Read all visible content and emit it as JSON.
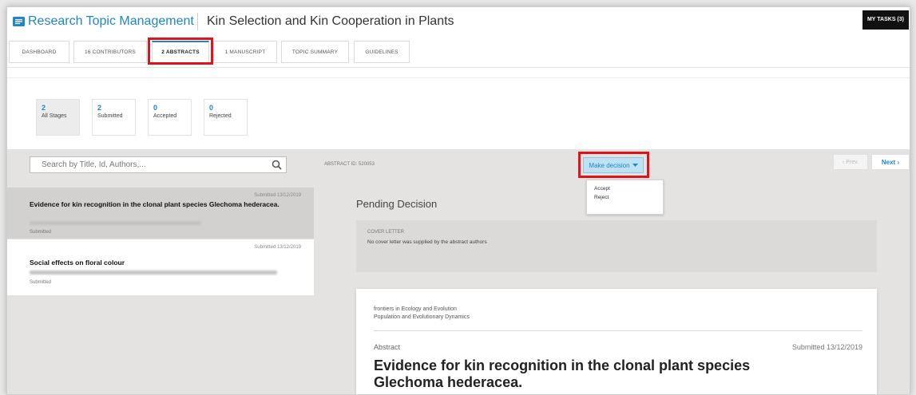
{
  "header": {
    "app_title": "Research Topic Management",
    "topic_title": "Kin Selection and Kin Cooperation in Plants",
    "tasks_button": "MY TASKS (3)"
  },
  "tabs": [
    {
      "label": "DASHBOARD",
      "active": false
    },
    {
      "label": "16 CONTRIBUTORS",
      "active": false
    },
    {
      "label": "2 ABSTRACTS",
      "active": true
    },
    {
      "label": "1 MANUSCRIPT",
      "active": false
    },
    {
      "label": "TOPIC SUMMARY",
      "active": false
    },
    {
      "label": "GUIDELINES",
      "active": false
    }
  ],
  "stats": [
    {
      "count": "2",
      "label": "All Stages",
      "active": true
    },
    {
      "count": "2",
      "label": "Submitted",
      "active": false
    },
    {
      "count": "0",
      "label": "Accepted",
      "active": false
    },
    {
      "count": "0",
      "label": "Rejected",
      "active": false
    }
  ],
  "search": {
    "placeholder": "Search by Title, Id, Authors,..."
  },
  "abstract_list": [
    {
      "date": "Submitted 13/12/2019",
      "title": "Evidence for kin recognition in the clonal plant species Glechoma hederacea.",
      "status": "Submitted",
      "selected": true
    },
    {
      "date": "Submitted 13/12/2019",
      "title": "Social effects on floral colour",
      "status": "Submitted",
      "selected": false
    }
  ],
  "detail": {
    "abstract_id": "ABSTRACT ID: 520053",
    "decision_button": "Make decision",
    "decision_options": [
      "Accept",
      "Reject"
    ],
    "prev_button": "‹ Prev.",
    "next_button": "Next ›",
    "status_heading": "Pending Decision",
    "cover_letter_label": "COVER LETTER",
    "cover_letter_text": "No cover letter was supplied by the abstract authors",
    "journal": "frontiers in Ecology and Evolution",
    "section": "Population and Evolutionary Dynamics",
    "abstract_label": "Abstract",
    "abstract_date": "Submitted 13/12/2019",
    "abstract_title": "Evidence for kin recognition in the clonal plant species Glechoma hederacea."
  },
  "colors": {
    "accent": "#1e87c9",
    "highlight": "#e2121b"
  }
}
